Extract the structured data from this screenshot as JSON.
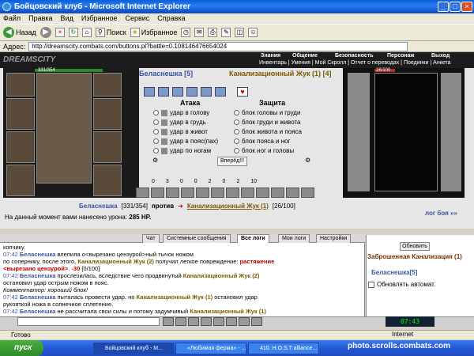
{
  "window": {
    "title": "Бойцовский клуб - Microsoft Internet Explorer"
  },
  "menu": [
    "Файл",
    "Правка",
    "Вид",
    "Избранное",
    "Сервис",
    "Справка"
  ],
  "toolbar": {
    "back": "Назад",
    "search": "Поиск",
    "favorites": "Избранное"
  },
  "address": {
    "label": "Адрес:",
    "url": "http://dreamscity.combats.com/buttons.pl?battle=0.108146476654024"
  },
  "game_header": {
    "logo": "DREAMSCITY",
    "top_links": [
      "Знания",
      "Общение",
      "Безопасность",
      "Персонаж",
      "Выход"
    ],
    "bottom_links": [
      "Инвентарь | Умения | Мой Скролл | Отчет о переводах | Поединки | Анкета"
    ]
  },
  "player": {
    "name": "Беласнешка [5]",
    "hp": "331/354"
  },
  "enemy": {
    "name": "Канализационный Жук (1) [4]",
    "hp": "26/100"
  },
  "attack": {
    "title": "Атака",
    "options": [
      "удар в голову",
      "удар в грудь",
      "удар в живот",
      "удар в пояс(пах)",
      "удар по ногам"
    ]
  },
  "defense": {
    "title": "Защита",
    "options": [
      "блок головы и груди",
      "блок груди и живота",
      "блок живота и пояса",
      "блок пояса и ног",
      "блок ног и головы"
    ]
  },
  "forward_button": "Вперёд!!!",
  "battle_stats": [
    "0",
    "3",
    "0",
    "0",
    "2",
    "0",
    "2",
    "10"
  ],
  "vs": {
    "player": "Беласнешка",
    "player_hp": "[331/354]",
    "word": "против",
    "enemy": "Канализационный Жук (1)",
    "enemy_hp": "[26/100]"
  },
  "damage": {
    "text": "На данный момент вами нанесено урона:",
    "value": "285 HP."
  },
  "battle_log_link": "лог боя »»",
  "tabs": [
    "Чат",
    "Системные сообщения",
    "Все логи",
    "Мои логи",
    "Настройки"
  ],
  "chat_lines": [
    {
      "time": "",
      "parts": [
        {
          "c": "",
          "t": "копчику."
        }
      ]
    },
    {
      "time": "07:42",
      "parts": [
        {
          "c": "ent",
          "t": "Беласнешка"
        },
        {
          "c": "",
          "t": " влепила о<вырезано цензурой>ный тычок ножом"
        }
      ]
    },
    {
      "time": "",
      "parts": [
        {
          "c": "",
          "t": "по сопернику, после этого, "
        },
        {
          "c": "enm",
          "t": "Канализационный Жук (2)"
        },
        {
          "c": "",
          "t": " получил легкое повреждение: "
        },
        {
          "c": "red",
          "t": "растяжение"
        }
      ]
    },
    {
      "time": "",
      "parts": [
        {
          "c": "red",
          "t": "<вырезано цензурой>"
        },
        {
          "c": "",
          "t": ". "
        },
        {
          "c": "red",
          "t": "-30"
        },
        {
          "c": "",
          "t": " [0/100]"
        }
      ]
    },
    {
      "time": "07:42",
      "parts": [
        {
          "c": "ent",
          "t": "Беласнешка"
        },
        {
          "c": "",
          "t": " прослезилась, вследствие чего продвинутый "
        },
        {
          "c": "enm",
          "t": "Канализационный Жук (2)"
        }
      ]
    },
    {
      "time": "",
      "parts": [
        {
          "c": "",
          "t": "остановил удар острым ножом в пояс."
        }
      ]
    },
    {
      "time": "",
      "parts": [
        {
          "c": "itl",
          "t": "Комментатор: хороший блок!"
        }
      ]
    },
    {
      "time": "07:42",
      "parts": [
        {
          "c": "ent",
          "t": "Беласнешка"
        },
        {
          "c": "",
          "t": " пыталась провести удар, но "
        },
        {
          "c": "enm",
          "t": "Канализационный Жук (1)"
        },
        {
          "c": "",
          "t": " остановил удар"
        }
      ]
    },
    {
      "time": "",
      "parts": [
        {
          "c": "",
          "t": "рукояткой ножа в солнечное сплетение."
        }
      ]
    },
    {
      "time": "07:42",
      "parts": [
        {
          "c": "ent",
          "t": "Беласнешка"
        },
        {
          "c": "",
          "t": " не рассчитала свои силы и потому задумчивый "
        },
        {
          "c": "enm",
          "t": "Канализационный Жук (1)"
        }
      ]
    }
  ],
  "side": {
    "refresh": "Обновить",
    "location": "Заброшенная Канализация (1)",
    "nick": "Беласнешка[5]",
    "auto": "Обновлять автомат."
  },
  "clock": "07:43",
  "status": {
    "left": "Готово",
    "zone": "Internet"
  },
  "taskbar": {
    "start": "пуск",
    "apps": [
      "Бойцовский клуб - M...",
      "«Любимая ферма» - ...",
      "410. H.O.S.T alliance..."
    ],
    "watermark": "photo.scrolls.combats.com"
  },
  "colors": {
    "entity_blue": "#3855a0",
    "enemy_gold": "#7a5a00",
    "damage_red": "#b80000"
  }
}
